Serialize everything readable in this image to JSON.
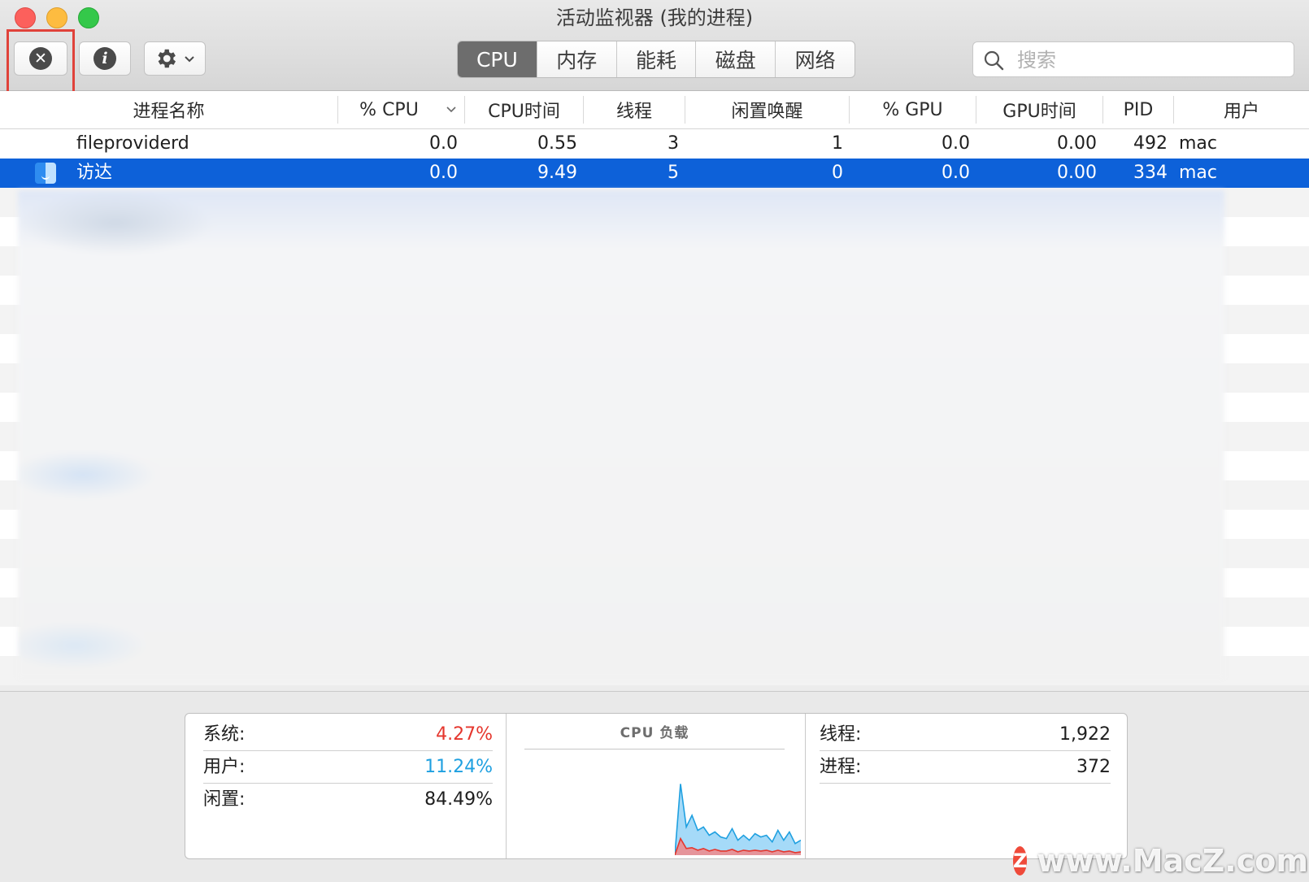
{
  "window": {
    "title": "活动监视器 (我的进程)"
  },
  "toolbar": {
    "quit_icon": "x-circle-icon",
    "info_icon": "info-circle-icon",
    "gear_icon": "gear-icon",
    "tabs": [
      {
        "label": "CPU",
        "active": true
      },
      {
        "label": "内存",
        "active": false
      },
      {
        "label": "能耗",
        "active": false
      },
      {
        "label": "磁盘",
        "active": false
      },
      {
        "label": "网络",
        "active": false
      }
    ],
    "search": {
      "placeholder": "搜索",
      "value": ""
    }
  },
  "table": {
    "columns": [
      "进程名称",
      "% CPU",
      "CPU时间",
      "线程",
      "闲置唤醒",
      "% GPU",
      "GPU时间",
      "PID",
      "用户"
    ],
    "sort_column": "% CPU",
    "rows": [
      {
        "name": "fileproviderd",
        "cpu": "0.0",
        "cpu_time": "0.55",
        "threads": "3",
        "idle_wakeups": "1",
        "gpu": "0.0",
        "gpu_time": "0.00",
        "pid": "492",
        "user": "mac",
        "selected": false
      },
      {
        "name": "访达",
        "cpu": "0.0",
        "cpu_time": "9.49",
        "threads": "5",
        "idle_wakeups": "0",
        "gpu": "0.0",
        "gpu_time": "0.00",
        "pid": "334",
        "user": "mac",
        "selected": true,
        "icon": "finder-icon"
      }
    ]
  },
  "summary": {
    "left": [
      {
        "label": "系统:",
        "value": "4.27%",
        "color": "#e5362d"
      },
      {
        "label": "用户:",
        "value": "11.24%",
        "color": "#1fa0e0"
      },
      {
        "label": "闲置:",
        "value": "84.49%",
        "color": "#1e1e1e"
      }
    ],
    "chart_title": "CPU 负载",
    "right": [
      {
        "label": "线程:",
        "value": "1,922"
      },
      {
        "label": "进程:",
        "value": "372"
      }
    ]
  },
  "colors": {
    "selection": "#0d61d9",
    "system_load": "#e5362d",
    "user_load": "#1fa0e0"
  },
  "chart_data": {
    "type": "area",
    "series": [
      {
        "values": [
          0,
          86,
          34,
          48,
          30,
          34,
          24,
          28,
          22,
          20,
          32,
          18,
          24,
          18,
          26,
          22,
          24,
          16,
          30,
          18,
          28,
          14,
          18
        ]
      },
      {
        "values": [
          0,
          20,
          8,
          9,
          6,
          8,
          5,
          7,
          5,
          5,
          7,
          4,
          6,
          5,
          6,
          5,
          6,
          4,
          6,
          4,
          5,
          3,
          4
        ]
      }
    ],
    "ylim": [
      0,
      100
    ]
  },
  "watermark": {
    "logo": "Z",
    "text": "www.MacZ.com"
  }
}
